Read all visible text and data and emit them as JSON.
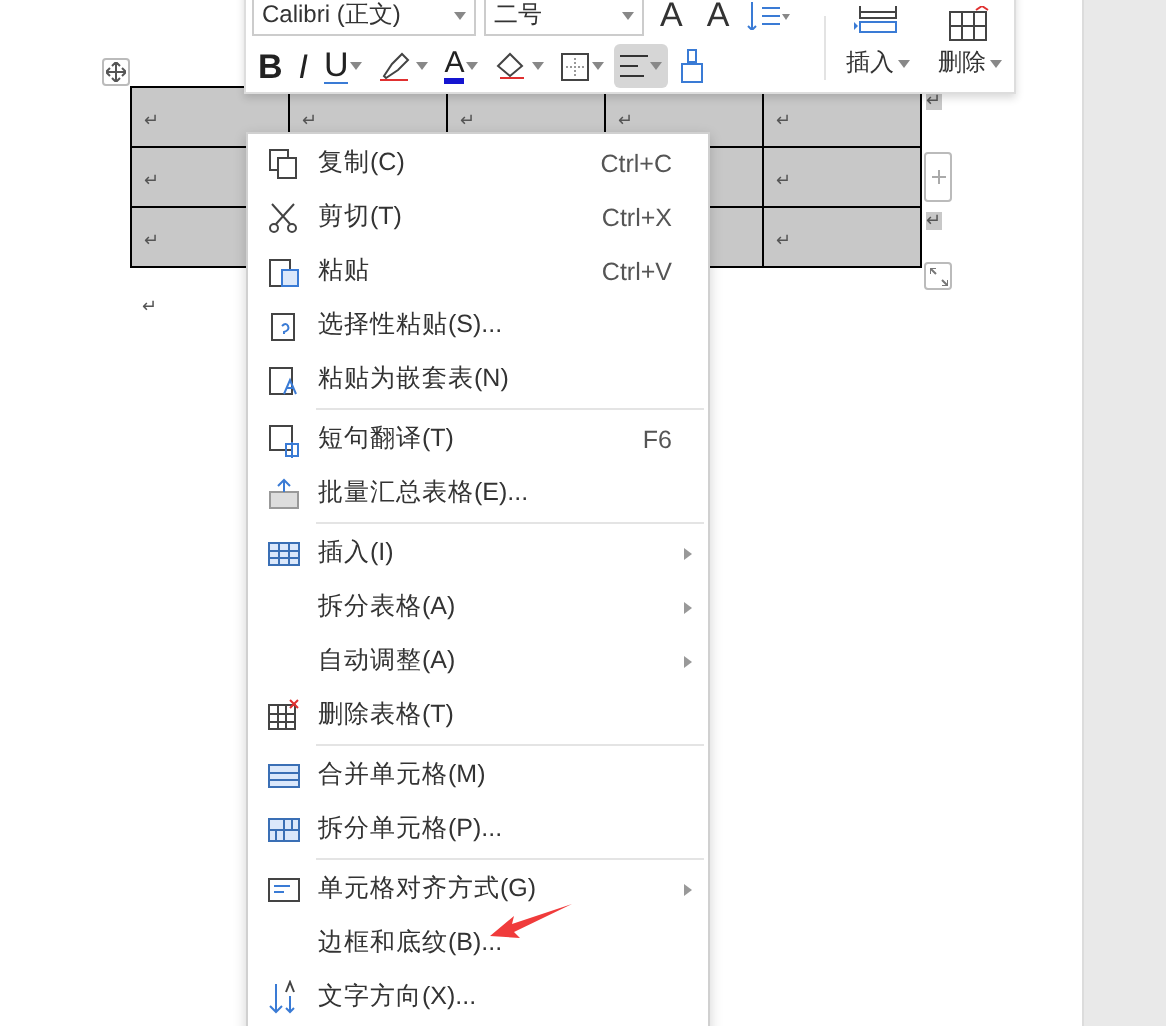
{
  "toolbar": {
    "font_name": "Calibri (正文)",
    "font_size": "二号",
    "size_buttons": [
      "A",
      "A"
    ],
    "format_buttons": [
      {
        "label": "B",
        "kind": "bold"
      },
      {
        "label": "I",
        "kind": "italic"
      },
      {
        "label": "U",
        "kind": "underline"
      }
    ],
    "font_color_label": "A",
    "align_selected": true,
    "table_buttons": [
      {
        "label": "插入"
      },
      {
        "label": "删除"
      }
    ]
  },
  "table": {
    "rows": [
      {
        "cells": [
          "↵",
          "↵",
          "↵",
          "↵",
          "↵"
        ]
      },
      {
        "cells": [
          "↵",
          "",
          "",
          "",
          "↵"
        ]
      },
      {
        "cells": [
          "↵",
          "",
          "",
          "",
          "↵"
        ]
      }
    ],
    "row_marks": [
      "↵",
      "↵"
    ],
    "after_mark": "↵"
  },
  "context_menu": {
    "items": [
      {
        "kind": "item",
        "label": "复制(C)",
        "shortcut": "Ctrl+C",
        "submenu": false
      },
      {
        "kind": "item",
        "label": "剪切(T)",
        "shortcut": "Ctrl+X",
        "submenu": false
      },
      {
        "kind": "item",
        "label": "粘贴",
        "shortcut": "Ctrl+V",
        "submenu": false
      },
      {
        "kind": "item",
        "label": "选择性粘贴(S)...",
        "submenu": false
      },
      {
        "kind": "item",
        "label": "粘贴为嵌套表(N)",
        "submenu": false
      },
      {
        "kind": "separator"
      },
      {
        "kind": "item",
        "label": "短句翻译(T)",
        "shortcut": "F6",
        "submenu": false
      },
      {
        "kind": "item",
        "label": "批量汇总表格(E)...",
        "submenu": false
      },
      {
        "kind": "separator"
      },
      {
        "kind": "item",
        "label": "插入(I)",
        "submenu": true
      },
      {
        "kind": "item",
        "label": "拆分表格(A)",
        "submenu": true
      },
      {
        "kind": "item",
        "label": "自动调整(A)",
        "submenu": true
      },
      {
        "kind": "item",
        "label": "删除表格(T)",
        "submenu": false
      },
      {
        "kind": "separator"
      },
      {
        "kind": "item",
        "label": "合并单元格(M)",
        "submenu": false
      },
      {
        "kind": "item",
        "label": "拆分单元格(P)...",
        "submenu": false
      },
      {
        "kind": "separator"
      },
      {
        "kind": "item",
        "label": "单元格对齐方式(G)",
        "submenu": true
      },
      {
        "kind": "item",
        "label": "边框和底纹(B)...",
        "submenu": false
      },
      {
        "kind": "item",
        "label": "文字方向(X)...",
        "submenu": false
      }
    ]
  }
}
